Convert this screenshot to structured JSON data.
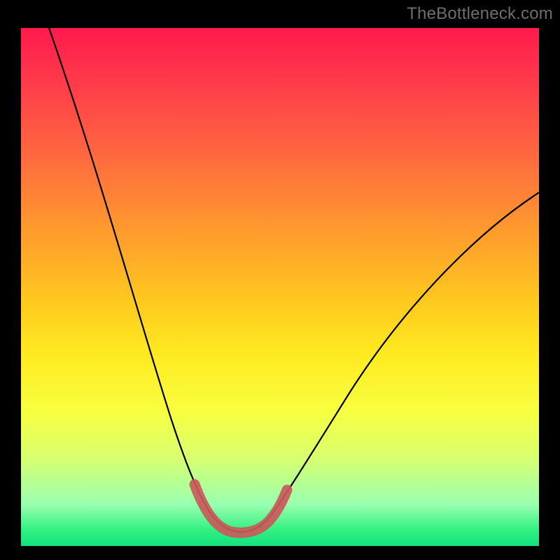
{
  "watermark": "TheBottleneck.com",
  "chart_data": {
    "type": "line",
    "title": "",
    "xlabel": "",
    "ylabel": "",
    "xlim": [
      0,
      100
    ],
    "ylim": [
      0,
      100
    ],
    "x": [
      0,
      5,
      10,
      15,
      20,
      25,
      30,
      33,
      36,
      38,
      40,
      42,
      44,
      46,
      48,
      50,
      55,
      60,
      65,
      70,
      75,
      80,
      85,
      90,
      95,
      100
    ],
    "series": [
      {
        "name": "bottleneck-curve",
        "values": [
          100,
          88,
          76,
          64,
          52,
          40,
          27,
          17,
          9,
          5,
          3,
          2,
          2,
          3,
          4,
          7,
          14,
          22,
          30,
          37,
          44,
          50,
          56,
          61,
          65,
          68
        ]
      }
    ],
    "highlight": {
      "name": "optimal-zone",
      "x": [
        33,
        35,
        37,
        38.5,
        40,
        42,
        44,
        45.5,
        47,
        49
      ],
      "y": [
        14,
        9.5,
        6,
        4.2,
        3.2,
        2.6,
        2.8,
        3.6,
        5.2,
        8.2
      ],
      "color": "#c95a5a"
    },
    "gradient_background": {
      "top": "#ff1a4d",
      "middle": "#ffea20",
      "bottom": "#13e27f"
    }
  }
}
